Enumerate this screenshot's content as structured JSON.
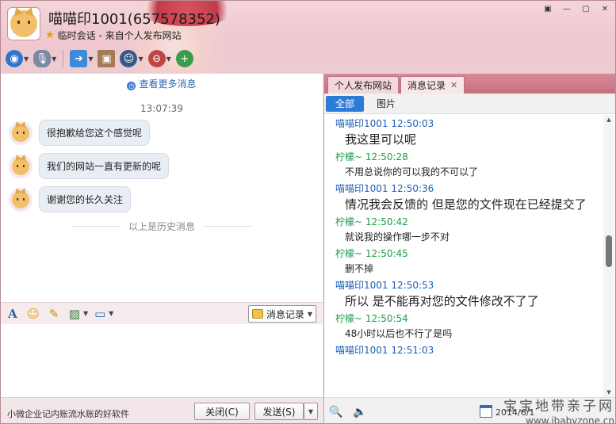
{
  "window": {
    "title": "喵喵印1001(657578352)",
    "subtitle": "临时会话 - 来自个人发布网站",
    "buttons": [
      "▣",
      "—",
      "▢",
      "✕"
    ]
  },
  "colors": {
    "accent": "#2d7bd8",
    "sender_a": "#1f5fb7",
    "sender_b": "#1e9b4b",
    "header": "#efc7cf"
  },
  "toolbar": {
    "icons": [
      "video-call-icon",
      "voice-call-icon",
      "file-transfer-icon",
      "screen-share-icon",
      "contact-card-icon",
      "block-user-icon",
      "add-friend-icon"
    ]
  },
  "chat": {
    "more_messages": "查看更多消息",
    "time": "13:07:39",
    "messages": [
      {
        "text": "很抱歉给您这个感觉呢"
      },
      {
        "text": "我们的网站一直有更新的呢"
      },
      {
        "text": "谢谢您的长久关注"
      }
    ],
    "history_separator": "以上是历史消息"
  },
  "editor_toolbar": {
    "font_glyph": "A",
    "history_button": "消息记录"
  },
  "bottom": {
    "promo": "小微企业记内账流水账的好软件",
    "close": "关闭(C)",
    "send": "发送(S)"
  },
  "right": {
    "tabs": [
      {
        "label": "个人发布网站"
      },
      {
        "label": "消息记录"
      }
    ],
    "filters": [
      {
        "label": "全部"
      },
      {
        "label": "图片"
      }
    ],
    "log": [
      {
        "sender": "喵喵印1001",
        "time": "12:50:03",
        "side": "a",
        "text": "我这里可以呢",
        "size": "big"
      },
      {
        "sender": "柠檬~",
        "time": "12:50:28",
        "side": "b",
        "text": "不用总说你的可以我的不可以了",
        "size": "small"
      },
      {
        "sender": "喵喵印1001",
        "time": "12:50:36",
        "side": "a",
        "text": "情况我会反馈的 但是您的文件现在已经提交了",
        "size": "big"
      },
      {
        "sender": "柠檬~",
        "time": "12:50:42",
        "side": "b",
        "text": "就说我的操作哪一步不对",
        "size": "small"
      },
      {
        "sender": "柠檬~",
        "time": "12:50:45",
        "side": "b",
        "text": "删不掉",
        "size": "small"
      },
      {
        "sender": "喵喵印1001",
        "time": "12:50:53",
        "side": "a",
        "text": "所以 是不能再对您的文件修改不了了",
        "size": "big"
      },
      {
        "sender": "柠檬~",
        "time": "12:50:54",
        "side": "b",
        "text": "48小时以后也不行了是吗",
        "size": "small"
      },
      {
        "sender": "喵喵印1001",
        "time": "12:51:03",
        "side": "a",
        "text": "",
        "size": "big"
      }
    ],
    "date_partial": "2014/6/1",
    "watermark_cn": "宝宝地带亲子网",
    "watermark_url": "www.ibabyzone.cn"
  }
}
